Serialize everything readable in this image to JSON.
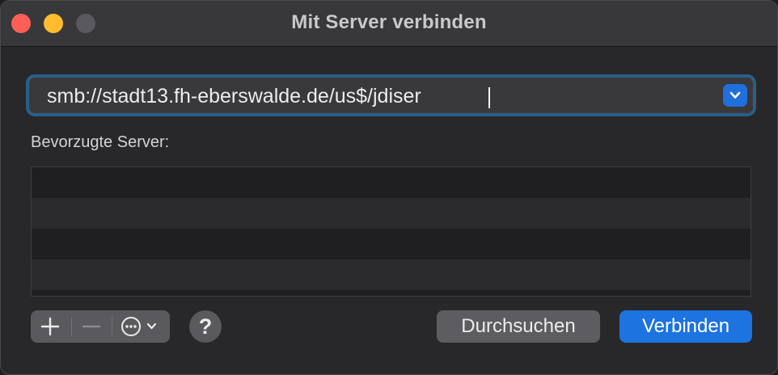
{
  "window": {
    "title": "Mit Server verbinden"
  },
  "address": {
    "value": "smb://stadt13.fh-eberswalde.de/us$/jdiser",
    "dropdown_icon": "chevron-down-icon"
  },
  "favorites": {
    "label": "Bevorzugte Server:",
    "rows": [
      "",
      "",
      "",
      ""
    ]
  },
  "toolbar": {
    "add_icon": "plus-icon",
    "remove_icon": "minus-icon",
    "action_icon": "ellipsis-circle-icon",
    "help_label": "?"
  },
  "buttons": {
    "browse_label": "Durchsuchen",
    "connect_label": "Verbinden"
  },
  "colors": {
    "accent": "#1d73e0",
    "focus_ring": "#2b5f86",
    "close": "#ff5f57",
    "minimize": "#febc2e"
  }
}
